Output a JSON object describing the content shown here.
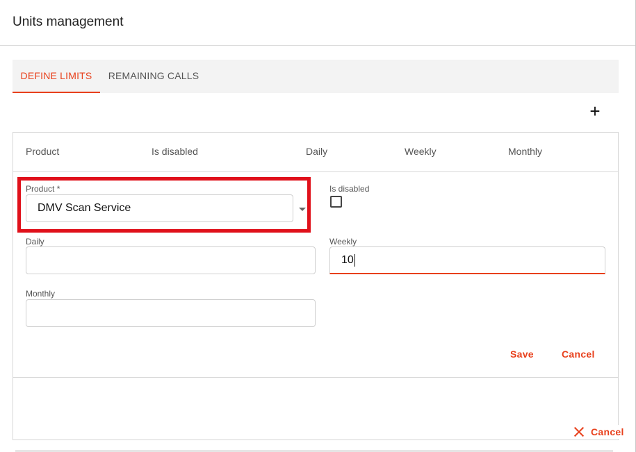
{
  "dialog": {
    "title": "Units management"
  },
  "tabs": [
    {
      "label": "DEFINE LIMITS",
      "active": true
    },
    {
      "label": "REMAINING CALLS",
      "active": false
    }
  ],
  "toolbar": {
    "add_label": "+"
  },
  "table": {
    "headers": [
      "Product",
      "Is disabled",
      "Daily",
      "Weekly",
      "Monthly"
    ]
  },
  "form": {
    "product_label": "Product *",
    "product_value": "DMV Scan Service",
    "disabled_label": "Is disabled",
    "disabled_checked": false,
    "daily_label": "Daily",
    "daily_value": "",
    "weekly_label": "Weekly",
    "weekly_value": "10",
    "monthly_label": "Monthly",
    "monthly_value": "",
    "save_label": "Save",
    "cancel_label": "Cancel"
  },
  "footer": {
    "cancel_label": "Cancel"
  },
  "colors": {
    "accent": "#e8401c",
    "highlight": "#e0101a"
  }
}
